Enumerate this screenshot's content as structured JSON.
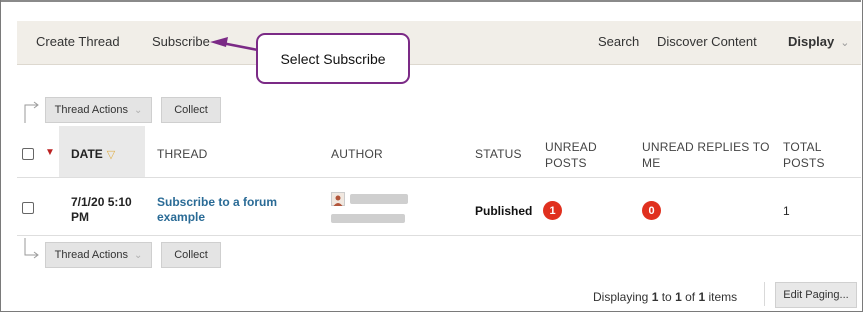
{
  "action_bar": {
    "create_thread": "Create Thread",
    "subscribe": "Subscribe",
    "search": "Search",
    "discover_content": "Discover Content",
    "display": "Display"
  },
  "callout": {
    "text": "Select Subscribe",
    "border_color": "#7b2a86"
  },
  "toolbar": {
    "thread_actions": "Thread Actions",
    "collect": "Collect"
  },
  "table": {
    "headers": {
      "date": "DATE",
      "thread": "THREAD",
      "author": "AUTHOR",
      "status": "STATUS",
      "unread_posts": [
        "UNREAD",
        "POSTS"
      ],
      "unread_replies": [
        "UNREAD REPLIES TO",
        "ME"
      ],
      "total_posts": [
        "TOTAL",
        "POSTS"
      ]
    },
    "rows": [
      {
        "date": [
          "7/1/20 5:10",
          "PM"
        ],
        "thread": [
          "Subscribe to a forum",
          "example"
        ],
        "status": "Published",
        "unread_posts": "1",
        "unread_replies": "0",
        "total_posts": "1"
      }
    ]
  },
  "footer": {
    "paging_prefix": "Displaying ",
    "from": "1",
    "to_word": " to ",
    "to": "1",
    "of_word": " of ",
    "total": "1",
    "items_word": " items",
    "edit_paging": "Edit Paging..."
  },
  "icons": {
    "chevron": "chevron-down-icon",
    "sort": "sort-triangle-icon",
    "flag": "flag-icon",
    "avatar": "avatar"
  },
  "colors": {
    "link": "#2a6b96",
    "badge": "#e0301e",
    "action_bar_bg": "#f1eee8",
    "sort_triangle": "#e0b04a"
  }
}
